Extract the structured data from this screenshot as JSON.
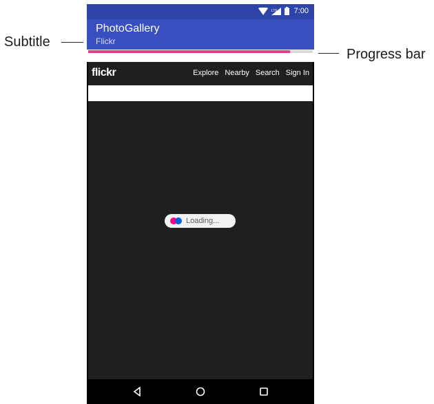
{
  "callouts": {
    "subtitle_label": "Subtitle",
    "progress_label": "Progress bar"
  },
  "status_bar": {
    "time": "7:00",
    "icons": [
      "wifi-icon",
      "cell-signal-icon",
      "battery-icon"
    ],
    "color": "#2f44a8"
  },
  "app_bar": {
    "title": "PhotoGallery",
    "subtitle": "Flickr",
    "color": "#3a4fbf"
  },
  "progress": {
    "value_fraction": 0.9,
    "fill_color": "#e33c8e",
    "track_color": "#d8d8d8"
  },
  "flickr_header": {
    "logo": "flickr",
    "nav_items": [
      "Explore",
      "Nearby",
      "Search",
      "Sign In"
    ]
  },
  "content": {
    "loading_text": "Loading...",
    "background": "#1f1f22"
  },
  "nav_bar": {
    "buttons": [
      "back-icon",
      "home-icon",
      "recent-apps-icon"
    ]
  }
}
